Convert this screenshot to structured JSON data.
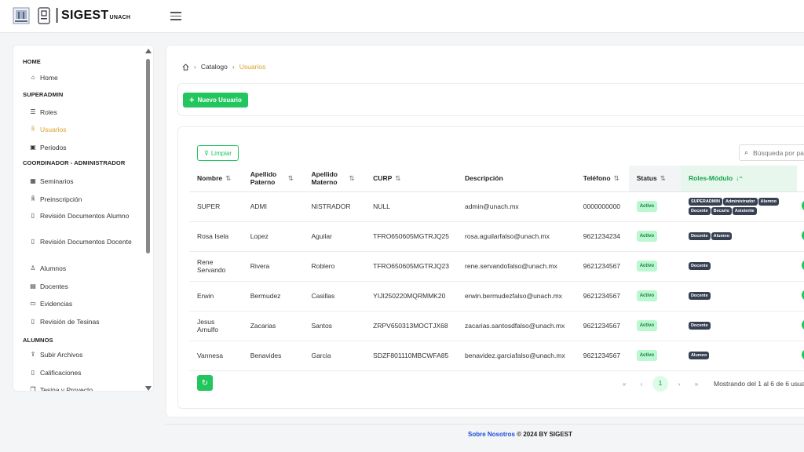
{
  "header": {
    "app_name": "SIGEST",
    "app_suffix": "UNACH",
    "separator": "|"
  },
  "sidebar": {
    "sections": [
      {
        "title": "HOME",
        "items": [
          {
            "label": "Home",
            "icon": "home-icon"
          }
        ]
      },
      {
        "title": "SUPERADMIN",
        "items": [
          {
            "label": "Roles",
            "icon": "list-icon"
          },
          {
            "label": "Usuarios",
            "icon": "users-icon",
            "active": true
          },
          {
            "label": "Periodos",
            "icon": "calendar-icon"
          }
        ]
      },
      {
        "title": "COORDINADOR - ADMINISTRADOR",
        "items": [
          {
            "label": "Seminarios",
            "icon": "grid-icon"
          },
          {
            "label": "Preinscripción",
            "icon": "users-icon"
          },
          {
            "label": "Revisión Documentos Alumno",
            "icon": "file-icon"
          },
          {
            "label": "Revisión Documentos Docente",
            "icon": "file-icon"
          },
          {
            "label": "Alumnos",
            "icon": "user-icon"
          },
          {
            "label": "Docentes",
            "icon": "book-icon"
          },
          {
            "label": "Evidencias",
            "icon": "folder-icon"
          },
          {
            "label": "Revisión de Tesinas",
            "icon": "file-icon"
          }
        ]
      },
      {
        "title": "ALUMNOS",
        "items": [
          {
            "label": "Subir Archivos",
            "icon": "upload-icon"
          },
          {
            "label": "Calificaciones",
            "icon": "file-icon"
          },
          {
            "label": "Tesina y Proyecto",
            "icon": "copy-icon"
          }
        ]
      }
    ]
  },
  "breadcrumb": {
    "home_icon": "home-icon",
    "parent": "Catalogo",
    "current": "Usuarios"
  },
  "toolbar": {
    "new_user_label": "Nuevo Usuario"
  },
  "table": {
    "clear_label": "Limpiar",
    "search_placeholder": "Búsqueda por palabra",
    "columns": {
      "nombre": "Nombre",
      "paterno": "Apellido Paterno",
      "materno": "Apellido Materno",
      "curp": "CURP",
      "descripcion": "Descripción",
      "telefono": "Teléfono",
      "status": "Status",
      "roles": "Roles-Módulo",
      "acciones": "A"
    },
    "rows": [
      {
        "nombre": "SUPER",
        "paterno": "ADMI",
        "materno": "NISTRADOR",
        "curp": "NULL",
        "descripcion": "admin@unach.mx",
        "telefono": "0000000000",
        "status": "Activo",
        "roles": [
          "SUPERADMIN",
          "Administrador",
          "Alumno",
          "Docente",
          "Becario",
          "Asistente"
        ]
      },
      {
        "nombre": "Rosa Isela",
        "paterno": "Lopez",
        "materno": "Aguilar",
        "curp": "TFRO650605MGTRJQ25",
        "descripcion": "rosa.aguilarfalso@unach.mx",
        "telefono": "9621234234",
        "status": "Activo",
        "roles": [
          "Docente",
          "Alumno"
        ]
      },
      {
        "nombre": "Rene Servando",
        "paterno": "Rivera",
        "materno": "Roblero",
        "curp": "TFRO650605MGTRJQ23",
        "descripcion": "rene.servandofalso@unach.mx",
        "telefono": "9621234567",
        "status": "Activo",
        "roles": [
          "Docente"
        ]
      },
      {
        "nombre": "Erwin",
        "paterno": "Bermudez",
        "materno": "Casillas",
        "curp": "YIJI250220MQRMMK20",
        "descripcion": "erwin.bermudezfalso@unach.mx",
        "telefono": "9621234567",
        "status": "Activo",
        "roles": [
          "Docente"
        ]
      },
      {
        "nombre": "Jesus Arnulfo",
        "paterno": "Zacarias",
        "materno": "Santos",
        "curp": "ZRPV650313MOCTJX68",
        "descripcion": "zacarias.santosdfalso@unach.mx",
        "telefono": "9621234567",
        "status": "Activo",
        "roles": [
          "Docente"
        ]
      },
      {
        "nombre": "Vannesa",
        "paterno": "Benavides",
        "materno": "Garcia",
        "curp": "SDZF801110MBCWFA85",
        "descripcion": "benavidez.garciafalso@unach.mx",
        "telefono": "9621234567",
        "status": "Activo",
        "roles": [
          "Alumno"
        ]
      }
    ]
  },
  "pagination": {
    "first": "«",
    "prev": "‹",
    "current": "1",
    "next": "›",
    "last": "»",
    "info": "Mostrando del 1 al 6 de 6 usuarios"
  },
  "footer": {
    "link": "Sobre Nosotros",
    "text": " © 2024 BY SIGEST"
  },
  "colors": {
    "accent": "#22c55e",
    "active_nav": "#d8a22a",
    "role_badge": "#374151"
  }
}
